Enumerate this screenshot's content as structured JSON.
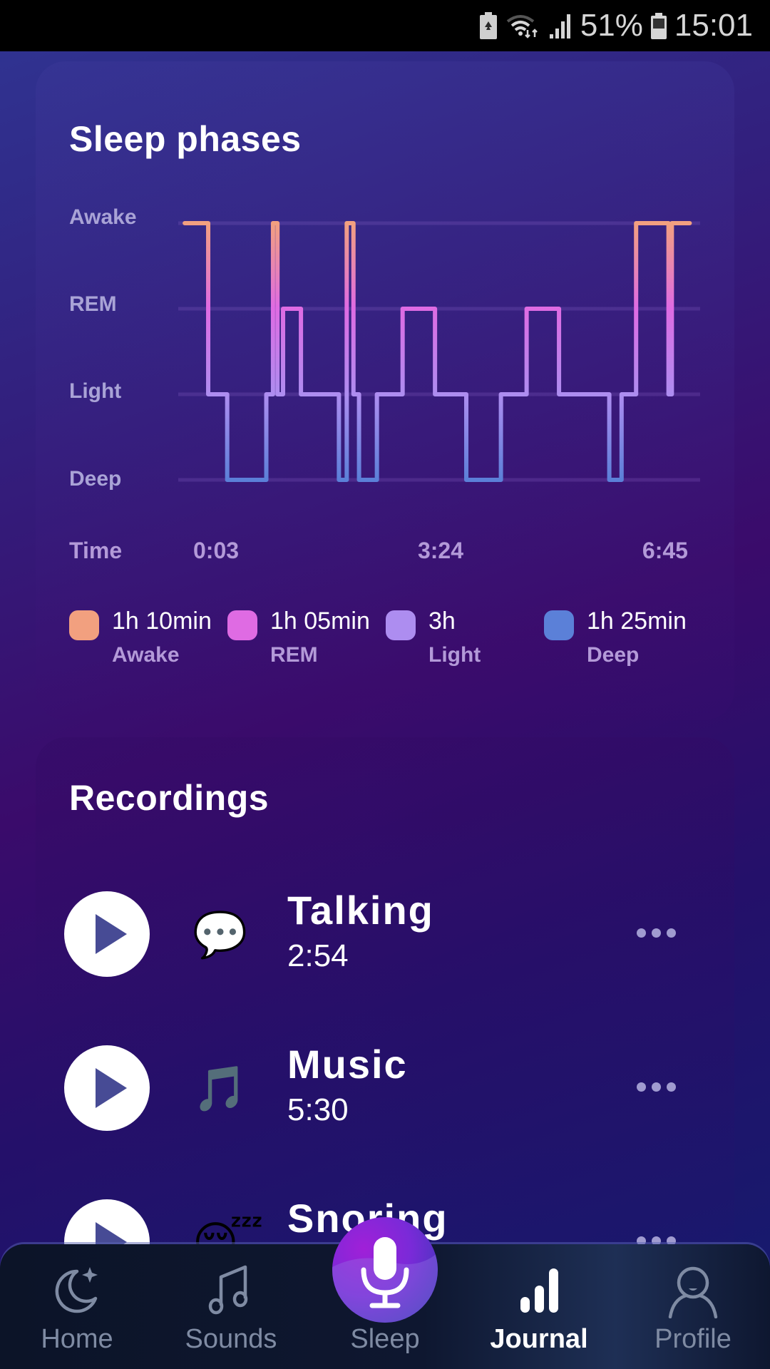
{
  "status_bar": {
    "icons": [
      "battery-saver-icon",
      "wifi-icon",
      "signal-icon",
      "battery-icon"
    ],
    "battery_percent": "51%",
    "time": "15:01"
  },
  "sleep_phases": {
    "title": "Sleep phases",
    "legend": [
      {
        "value": "1h 10min",
        "label": "Awake",
        "color": "#f2a07f"
      },
      {
        "value": "1h 05min",
        "label": "REM",
        "color": "#df6be3"
      },
      {
        "value": "3h",
        "label": "Light",
        "color": "#ad8df0"
      },
      {
        "value": "1h 25min",
        "label": "Deep",
        "color": "#5b80d8"
      }
    ]
  },
  "chart_data": {
    "type": "line",
    "title": "Sleep phases",
    "xlabel": "Time",
    "ylabel": "",
    "y_categories": [
      "Deep",
      "Light",
      "REM",
      "Awake"
    ],
    "x_tick_labels": [
      "0:03",
      "3:24",
      "6:45"
    ],
    "x_tick_minutes": [
      3,
      204,
      405
    ],
    "x_range_minutes": [
      -25,
      432
    ],
    "grid": true,
    "step": true,
    "line_gradient": {
      "Awake": "#f2a07f",
      "REM": "#df6be3",
      "Light": "#ad8df0",
      "Deep": "#5b80d8"
    },
    "series": [
      {
        "name": "Sleep stage",
        "points": [
          {
            "t": -25,
            "stage": "Awake"
          },
          {
            "t": -4,
            "stage": "Light"
          },
          {
            "t": 13,
            "stage": "Deep"
          },
          {
            "t": 48,
            "stage": "Light"
          },
          {
            "t": 54,
            "stage": "Awake"
          },
          {
            "t": 58,
            "stage": "Light"
          },
          {
            "t": 63,
            "stage": "REM"
          },
          {
            "t": 79,
            "stage": "Light"
          },
          {
            "t": 113,
            "stage": "Deep"
          },
          {
            "t": 120,
            "stage": "Awake"
          },
          {
            "t": 126,
            "stage": "Light"
          },
          {
            "t": 131,
            "stage": "Deep"
          },
          {
            "t": 147,
            "stage": "Light"
          },
          {
            "t": 170,
            "stage": "REM"
          },
          {
            "t": 199,
            "stage": "Light"
          },
          {
            "t": 227,
            "stage": "Deep"
          },
          {
            "t": 258,
            "stage": "Light"
          },
          {
            "t": 281,
            "stage": "REM"
          },
          {
            "t": 310,
            "stage": "Light"
          },
          {
            "t": 355,
            "stage": "Deep"
          },
          {
            "t": 366,
            "stage": "Light"
          },
          {
            "t": 379,
            "stage": "Awake"
          },
          {
            "t": 408,
            "stage": "Light"
          },
          {
            "t": 411,
            "stage": "Awake"
          },
          {
            "t": 427,
            "stage": "Awake"
          }
        ]
      }
    ],
    "legend": [
      {
        "name": "Awake",
        "duration": "1h 10min"
      },
      {
        "name": "REM",
        "duration": "1h 05min"
      },
      {
        "name": "Light",
        "duration": "3h"
      },
      {
        "name": "Deep",
        "duration": "1h 25min"
      }
    ]
  },
  "recordings": {
    "title": "Recordings",
    "items": [
      {
        "name": "Talking",
        "duration": "2:54",
        "emoji": "💬",
        "icon": "speech-bubble-icon"
      },
      {
        "name": "Music",
        "duration": "5:30",
        "emoji": "🎵",
        "icon": "music-note-icon"
      },
      {
        "name": "Snoring",
        "duration": "",
        "emoji": "😴",
        "icon": "sleeping-face-icon"
      }
    ]
  },
  "bottom_nav": {
    "items": [
      {
        "label": "Home",
        "icon": "moon-star-icon",
        "active": false
      },
      {
        "label": "Sounds",
        "icon": "music-note-icon",
        "active": false
      },
      {
        "label": "Sleep",
        "icon": "microphone-icon",
        "active": false
      },
      {
        "label": "Journal",
        "icon": "bar-chart-icon",
        "active": true
      },
      {
        "label": "Profile",
        "icon": "person-icon",
        "active": false
      }
    ]
  }
}
